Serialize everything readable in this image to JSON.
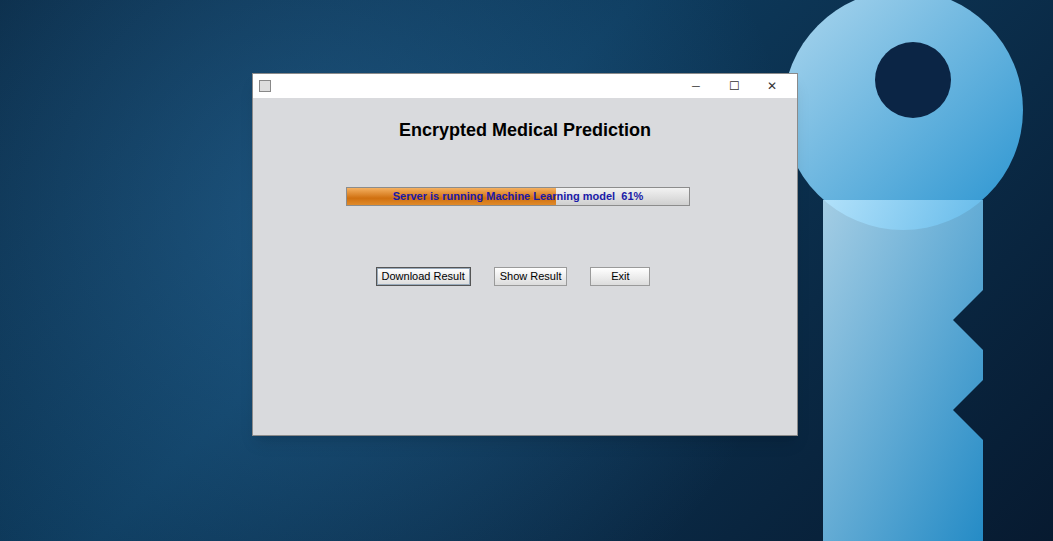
{
  "window": {
    "title": "",
    "controls": {
      "minimize": "─",
      "maximize": "☐",
      "close": "✕"
    }
  },
  "heading": "Encrypted Medical Prediction",
  "progress": {
    "label": "Server is running Machine Learning model  61%",
    "level": 0.61
  },
  "buttons": [
    {
      "label": "Download Result",
      "focused": true
    },
    {
      "label": "Show Result",
      "focused": false
    },
    {
      "label": "Exit",
      "focused": false
    }
  ]
}
